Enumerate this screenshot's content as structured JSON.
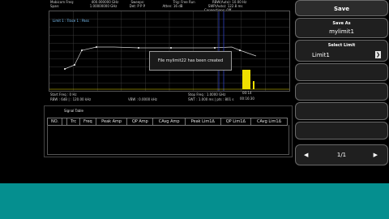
{
  "header": {
    "line1": [
      "Mobicom Freq:",
      "400.000000 GHz",
      "Sweeps:",
      "Trig: Free Run",
      "RBW(Auto): 10.00 Hz"
    ],
    "line2": [
      "Span:",
      "1.00000000 GHz",
      "Det:  P  P  P",
      "Atten: 16 dB",
      "SWP(Auto): 122.8 ms"
    ],
    "line3": [
      "",
      "",
      "",
      "Connections: Off",
      ""
    ]
  },
  "plot": {
    "title": "Limit 1 : Trace 1 : Pass",
    "popup": "File mylimit22 has been created"
  },
  "status": {
    "start_freq": "Start Freq : 0 Hz",
    "stop_freq": "Stop Freq : 1.0000 GHz",
    "rbw": "RBW : 6dB | : 120.00 kHz",
    "vbw": "VBW : 0.0000 kHz",
    "swt": "SWT : 1.000 ms | pts : 801 s",
    "marker1": "00:14",
    "marker2": "00:16:30"
  },
  "signal_table": {
    "title": "Signal Table",
    "columns": [
      "NO.",
      "",
      "Trc",
      "Freq",
      "Peak Amp",
      "QP Amp",
      "CAvg Amp",
      "Peak Lim1Δ",
      "QP Lim1Δ",
      "CAvg Lim1Δ"
    ]
  },
  "right_panel": {
    "save": "Save",
    "save_as_label": "Save As",
    "save_as_value": "mylimit1",
    "select_limit_label": "Select Limit",
    "select_limit_value": "Limit1",
    "pager_prev": "◀",
    "pager": "1/1",
    "pager_next": "▶"
  },
  "colors": {
    "accent": "#058f8f",
    "limit_line": "#cfcfcf",
    "marker_bar": "#f0e000",
    "marker_line": "#3040c0"
  }
}
